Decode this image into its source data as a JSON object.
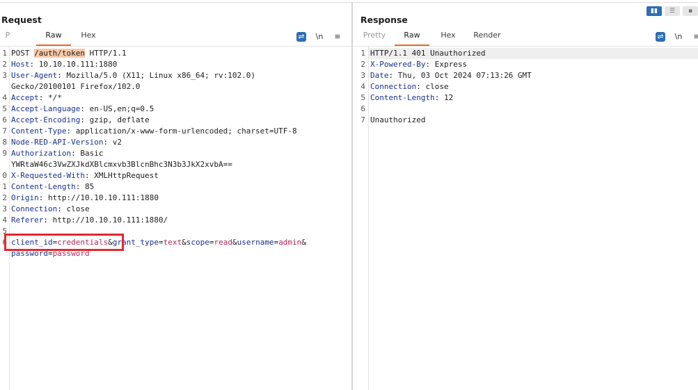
{
  "request": {
    "title": "Request",
    "tabs": [
      {
        "label": "P",
        "active": false,
        "muted": true
      },
      {
        "label": "Raw",
        "active": true
      },
      {
        "label": "Hex",
        "active": false
      }
    ],
    "tools": {
      "wrap_icon": "wrap-lines-icon",
      "newline": "\\n",
      "menu": "≡"
    },
    "lines": [
      {
        "n": "1",
        "parts": [
          {
            "t": "POST "
          },
          {
            "t": "/auth/token",
            "c": "hl"
          },
          {
            "t": " HTTP/1.1"
          }
        ]
      },
      {
        "n": "2",
        "parts": [
          {
            "t": "Host",
            "c": "hk"
          },
          {
            "t": ": 10.10.10.111:1880"
          }
        ]
      },
      {
        "n": "3",
        "parts": [
          {
            "t": "User-Agent",
            "c": "hk"
          },
          {
            "t": ": Mozilla/5.0 (X11; Linux x86_64; rv:102.0)"
          }
        ]
      },
      {
        "n": "",
        "parts": [
          {
            "t": "Gecko/20100101 Firefox/102.0"
          }
        ]
      },
      {
        "n": "4",
        "parts": [
          {
            "t": "Accept",
            "c": "hk"
          },
          {
            "t": ": */*"
          }
        ]
      },
      {
        "n": "5",
        "parts": [
          {
            "t": "Accept-Language",
            "c": "hk"
          },
          {
            "t": ": en-US,en;q=0.5"
          }
        ]
      },
      {
        "n": "6",
        "parts": [
          {
            "t": "Accept-Encoding",
            "c": "hk"
          },
          {
            "t": ": gzip, deflate"
          }
        ]
      },
      {
        "n": "7",
        "parts": [
          {
            "t": "Content-Type",
            "c": "hk"
          },
          {
            "t": ": application/x-www-form-urlencoded; charset=UTF-8"
          }
        ]
      },
      {
        "n": "8",
        "parts": [
          {
            "t": "Node-RED-API-Version",
            "c": "hk"
          },
          {
            "t": ": v2"
          }
        ]
      },
      {
        "n": "9",
        "parts": [
          {
            "t": "Authorization",
            "c": "hk"
          },
          {
            "t": ": Basic"
          }
        ]
      },
      {
        "n": "",
        "parts": [
          {
            "t": "YWRtaW46c3VwZXJkdXBlcmxvb3BlcnBhc3N3b3JkX2xvbA=="
          }
        ]
      },
      {
        "n": "0",
        "parts": [
          {
            "t": "X-Requested-With",
            "c": "hk"
          },
          {
            "t": ": XMLHttpRequest"
          }
        ]
      },
      {
        "n": "1",
        "parts": [
          {
            "t": "Content-Length",
            "c": "hk"
          },
          {
            "t": ": 85"
          }
        ]
      },
      {
        "n": "2",
        "parts": [
          {
            "t": "Origin",
            "c": "hk"
          },
          {
            "t": ": http://10.10.10.111:1880"
          }
        ]
      },
      {
        "n": "3",
        "parts": [
          {
            "t": "Connection",
            "c": "hk"
          },
          {
            "t": ": close"
          }
        ]
      },
      {
        "n": "4",
        "parts": [
          {
            "t": "Referer",
            "c": "hk"
          },
          {
            "t": ": http://10.10.10.111:1880/"
          }
        ]
      },
      {
        "n": "5",
        "parts": []
      },
      {
        "n": "6",
        "parts": [
          {
            "t": "client_id",
            "c": "hk"
          },
          {
            "t": "="
          },
          {
            "t": "credentials",
            "c": "pv"
          },
          {
            "t": "&"
          },
          {
            "t": "grant_type",
            "c": "hk"
          },
          {
            "t": "="
          },
          {
            "t": "text",
            "c": "pv"
          },
          {
            "t": "&"
          },
          {
            "t": "scope",
            "c": "hk"
          },
          {
            "t": "="
          },
          {
            "t": "read",
            "c": "pv"
          },
          {
            "t": "&"
          },
          {
            "t": "username",
            "c": "hk"
          },
          {
            "t": "="
          },
          {
            "t": "admin",
            "c": "pv"
          },
          {
            "t": "&"
          }
        ]
      },
      {
        "n": "",
        "parts": [
          {
            "t": "password",
            "c": "hk"
          },
          {
            "t": "="
          },
          {
            "t": "password",
            "c": "pv"
          }
        ]
      }
    ]
  },
  "response": {
    "title": "Response",
    "tabs": [
      {
        "label": "Pretty",
        "active": false,
        "muted": true
      },
      {
        "label": "Raw",
        "active": true
      },
      {
        "label": "Hex",
        "active": false
      },
      {
        "label": "Render",
        "active": false
      }
    ],
    "tools": {
      "wrap_icon": "wrap-lines-icon",
      "newline": "\\n",
      "menu": "≡"
    },
    "lines": [
      {
        "n": "1",
        "parts": [
          {
            "t": "HTTP/1.1 401 Unauthorized"
          }
        ]
      },
      {
        "n": "2",
        "parts": [
          {
            "t": "X-Powered-By",
            "c": "hk"
          },
          {
            "t": ": Express"
          }
        ]
      },
      {
        "n": "3",
        "parts": [
          {
            "t": "Date",
            "c": "hk"
          },
          {
            "t": ": Thu, 03 Oct 2024 07:13:26 GMT"
          }
        ]
      },
      {
        "n": "4",
        "parts": [
          {
            "t": "Connection",
            "c": "hk"
          },
          {
            "t": ": close"
          }
        ]
      },
      {
        "n": "5",
        "parts": [
          {
            "t": "Content-Length",
            "c": "hk"
          },
          {
            "t": ": 12"
          }
        ]
      },
      {
        "n": "6",
        "parts": []
      },
      {
        "n": "7",
        "parts": [
          {
            "t": "Unauthorized"
          }
        ]
      }
    ]
  },
  "layout_buttons": [
    "split-horizontal-icon",
    "split-vertical-icon",
    "single-pane-icon"
  ],
  "colors": {
    "accent": "#e8692b",
    "header_key": "#19328c",
    "param_value": "#b0295a",
    "highlight": "#f8c9a8",
    "annotation": "#e4272e",
    "tool_blue": "#2f6db5"
  }
}
